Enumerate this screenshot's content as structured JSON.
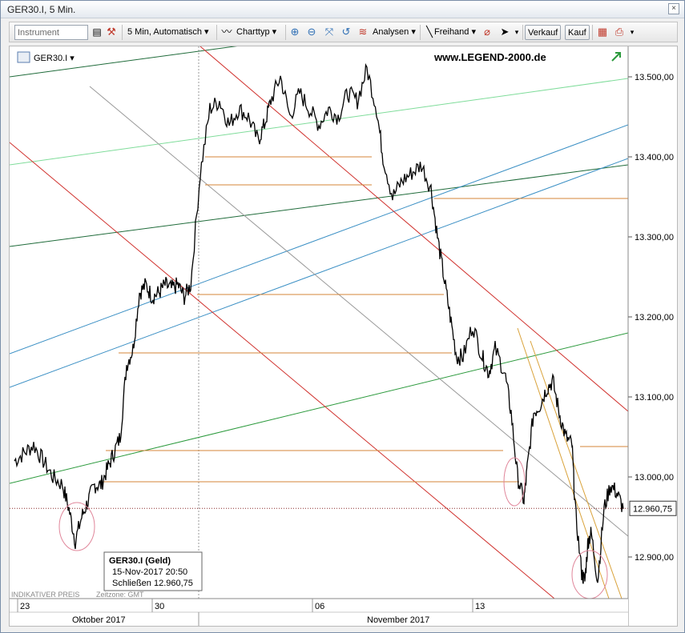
{
  "window": {
    "title": "GER30.I, 5 Min.",
    "close_glyph": "×"
  },
  "toolbar": {
    "instrument_placeholder": "Instrument",
    "timeframe_label": "5 Min,  Automatisch",
    "charttype_label": "Charttyp",
    "analysen_label": "Analysen",
    "freihand_label": "Freihand",
    "verkauf_label": "Verkauf",
    "kauf_label": "Kauf"
  },
  "header": {
    "symbol_label": "GER30.I",
    "watermark": "www.LEGEND-2000.de"
  },
  "footer": {
    "indicative_label": "INDIKATIVER PREIS",
    "timezone_label": "Zeitzone: GMT"
  },
  "tooltip": {
    "title": "GER30.I (Geld)",
    "datetime": "15-Nov-2017 20:50",
    "close_label": "Schließen",
    "close_value": "12.960,75"
  },
  "chart_data": {
    "type": "line",
    "symbol": "GER30.I",
    "timeframe": "5 Min.",
    "ylim": [
      12840,
      13560
    ],
    "yticks": [
      {
        "value": 12900,
        "label": "12.900,00"
      },
      {
        "value": 13000,
        "label": "13.000,00"
      },
      {
        "value": 13100,
        "label": "13.100,00"
      },
      {
        "value": 13200,
        "label": "13.200,00"
      },
      {
        "value": 13300,
        "label": "13.300,00"
      },
      {
        "value": 13400,
        "label": "13.400,00"
      },
      {
        "value": 13500,
        "label": "13.500,00"
      }
    ],
    "last_price": {
      "value": 12960.75,
      "label": "12.960,75"
    },
    "xlim": [
      0,
      18
    ],
    "xticks": [
      {
        "pos": 0.6,
        "label": "23"
      },
      {
        "pos": 4.8,
        "label": "30"
      },
      {
        "pos": 9.8,
        "label": "06"
      },
      {
        "pos": 14.8,
        "label": "13"
      }
    ],
    "month_labels": [
      {
        "pos": 2.8,
        "label": "Oktober 2017"
      },
      {
        "pos": 12.0,
        "label": "November 2017"
      }
    ],
    "price_series": [
      [
        0.0,
        13020
      ],
      [
        0.3,
        13030
      ],
      [
        0.6,
        13040
      ],
      [
        0.9,
        13020
      ],
      [
        1.2,
        13000
      ],
      [
        1.5,
        12990
      ],
      [
        1.7,
        12960
      ],
      [
        1.9,
        12920
      ],
      [
        2.1,
        12950
      ],
      [
        2.3,
        12970
      ],
      [
        2.5,
        12990
      ],
      [
        2.7,
        12990
      ],
      [
        2.9,
        13010
      ],
      [
        3.1,
        13030
      ],
      [
        3.3,
        13050
      ],
      [
        3.5,
        13140
      ],
      [
        3.7,
        13160
      ],
      [
        3.9,
        13230
      ],
      [
        4.1,
        13240
      ],
      [
        4.3,
        13225
      ],
      [
        4.5,
        13230
      ],
      [
        4.7,
        13240
      ],
      [
        4.9,
        13235
      ],
      [
        5.1,
        13240
      ],
      [
        5.3,
        13225
      ],
      [
        5.5,
        13240
      ],
      [
        5.8,
        13380
      ],
      [
        6.1,
        13460
      ],
      [
        6.4,
        13470
      ],
      [
        6.7,
        13440
      ],
      [
        7.0,
        13460
      ],
      [
        7.3,
        13450
      ],
      [
        7.6,
        13420
      ],
      [
        7.8,
        13440
      ],
      [
        8.0,
        13470
      ],
      [
        8.3,
        13500
      ],
      [
        8.6,
        13450
      ],
      [
        8.9,
        13480
      ],
      [
        9.2,
        13460
      ],
      [
        9.5,
        13440
      ],
      [
        9.8,
        13460
      ],
      [
        10.1,
        13450
      ],
      [
        10.4,
        13480
      ],
      [
        10.7,
        13470
      ],
      [
        11.0,
        13510
      ],
      [
        11.3,
        13460
      ],
      [
        11.5,
        13400
      ],
      [
        11.8,
        13350
      ],
      [
        12.1,
        13370
      ],
      [
        12.4,
        13380
      ],
      [
        12.7,
        13390
      ],
      [
        13.0,
        13360
      ],
      [
        13.2,
        13300
      ],
      [
        13.4,
        13250
      ],
      [
        13.6,
        13200
      ],
      [
        13.8,
        13150
      ],
      [
        14.0,
        13150
      ],
      [
        14.3,
        13190
      ],
      [
        14.6,
        13150
      ],
      [
        14.8,
        13130
      ],
      [
        15.0,
        13160
      ],
      [
        15.3,
        13130
      ],
      [
        15.5,
        13080
      ],
      [
        15.7,
        13000
      ],
      [
        15.9,
        12970
      ],
      [
        16.0,
        13010
      ],
      [
        16.2,
        13080
      ],
      [
        16.4,
        13090
      ],
      [
        16.6,
        13110
      ],
      [
        16.8,
        13120
      ],
      [
        17.0,
        13080
      ],
      [
        17.2,
        13050
      ],
      [
        17.4,
        13040
      ],
      [
        17.5,
        12960
      ],
      [
        17.7,
        12880
      ],
      [
        17.8,
        12870
      ],
      [
        17.9,
        12920
      ],
      [
        18.0,
        12930
      ],
      [
        18.2,
        12870
      ],
      [
        18.4,
        12960
      ],
      [
        18.6,
        12990
      ],
      [
        18.8,
        12980
      ],
      [
        19.0,
        12960
      ]
    ]
  },
  "colors": {
    "price": "#000000",
    "horizontal_levels": "#d4853a",
    "red_channel": "#d0312d",
    "gray_trend": "#999999",
    "blue_channel": "#3a8fc4",
    "light_green": "#7fdc9a",
    "dark_green": "#1f6b3a",
    "mid_green": "#2c9a3d",
    "ellipse": "#e0869a",
    "orange_channel": "#d9a23a"
  }
}
